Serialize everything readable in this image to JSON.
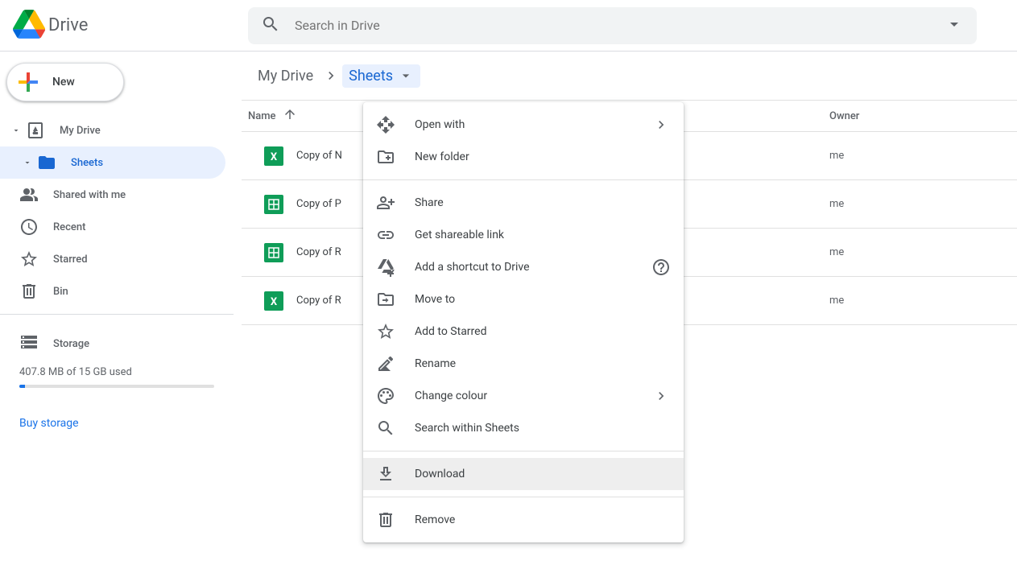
{
  "product_name": "Drive",
  "search": {
    "placeholder": "Search in Drive"
  },
  "new_button": {
    "label": "New"
  },
  "sidebar": {
    "tree": {
      "root": "My Drive",
      "child": "Sheets"
    },
    "items": [
      {
        "label": "Shared with me",
        "icon": "people"
      },
      {
        "label": "Recent",
        "icon": "clock"
      },
      {
        "label": "Starred",
        "icon": "star"
      },
      {
        "label": "Bin",
        "icon": "trash"
      }
    ],
    "storage": {
      "title": "Storage",
      "text": "407.8 MB of 15 GB used",
      "buy": "Buy storage"
    }
  },
  "breadcrumb": {
    "items": [
      "My Drive",
      "Sheets"
    ]
  },
  "table": {
    "columns": {
      "name": "Name",
      "owner": "Owner"
    },
    "rows": [
      {
        "name": "Copy of N",
        "owner": "me",
        "type": "xls"
      },
      {
        "name": "Copy of P",
        "owner": "me",
        "type": "gsheet"
      },
      {
        "name": "Copy of R",
        "owner": "me",
        "type": "gsheet"
      },
      {
        "name": "Copy of R",
        "owner": "me",
        "type": "xls"
      }
    ]
  },
  "context_menu": {
    "groups": [
      [
        {
          "label": "Open with",
          "icon": "open-with",
          "submenu": true
        },
        {
          "label": "New folder",
          "icon": "new-folder"
        }
      ],
      [
        {
          "label": "Share",
          "icon": "person-add"
        },
        {
          "label": "Get shareable link",
          "icon": "link"
        },
        {
          "label": "Add a shortcut to Drive",
          "icon": "drive-shortcut",
          "help": true
        },
        {
          "label": "Move to",
          "icon": "move"
        },
        {
          "label": "Add to Starred",
          "icon": "star"
        },
        {
          "label": "Rename",
          "icon": "pencil"
        },
        {
          "label": "Change colour",
          "icon": "palette",
          "submenu": true
        },
        {
          "label": "Search within Sheets",
          "icon": "search"
        }
      ],
      [
        {
          "label": "Download",
          "icon": "download",
          "highlight": true
        }
      ],
      [
        {
          "label": "Remove",
          "icon": "trash"
        }
      ]
    ]
  }
}
